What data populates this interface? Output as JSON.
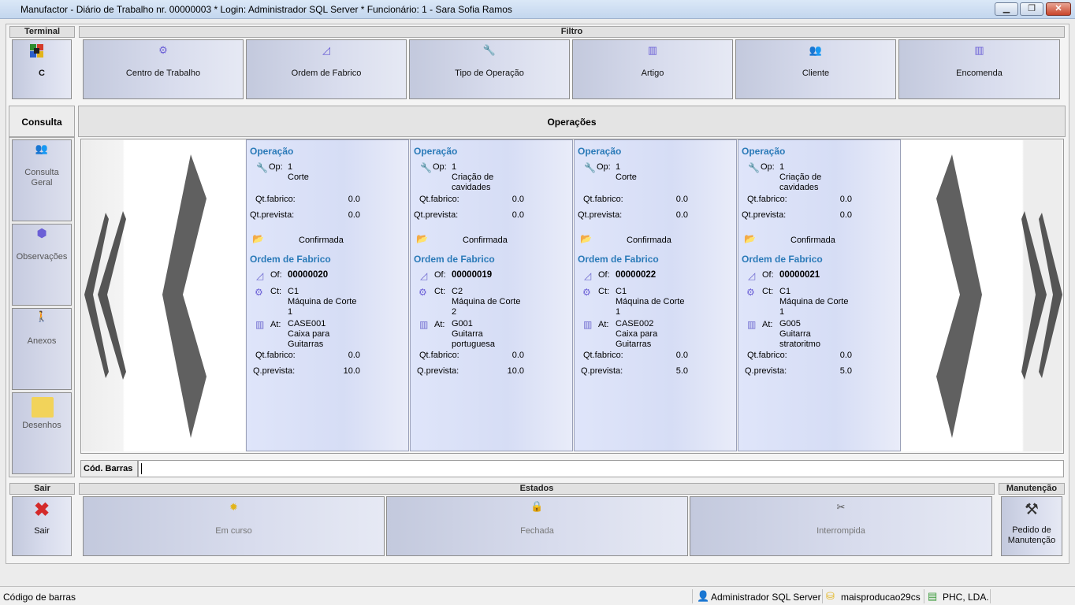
{
  "window": {
    "title": "Manufactor - Diário de Trabalho nr. 00000003 * Login: Administrador SQL Server * Funcionário: 1 - Sara Sofia Ramos"
  },
  "terminal": {
    "header": "Terminal",
    "value": "C"
  },
  "filtro": {
    "header": "Filtro",
    "buttons": [
      "Centro de Trabalho",
      "Ordem de Fabrico",
      "Tipo de Operação",
      "Artigo",
      "Cliente",
      "Encomenda"
    ]
  },
  "consulta": {
    "header": "Consulta",
    "items": [
      {
        "label_1": "Consulta",
        "label_2": "Geral"
      },
      {
        "label_1": "Observações"
      },
      {
        "label_1": "Anexos"
      },
      {
        "label_1": "Desenhos"
      }
    ]
  },
  "operacoes": {
    "header": "Operações"
  },
  "labels": {
    "operacao": "Operação",
    "op": "Op:",
    "qt_fabrico": "Qt.fabrico:",
    "qt_prevista": "Qt.prevista:",
    "ordem_fabrico": "Ordem de Fabrico",
    "of": "Of:",
    "ct": "Ct:",
    "at": "At:",
    "q_fabrico": "Qt.fabrico:",
    "q_prevista": "Q.prevista:"
  },
  "cards": [
    {
      "op_num": "1",
      "op_name_1": "Corte",
      "op_name_2": "",
      "qt_fabrico": "0.0",
      "qt_prevista": "0.0",
      "estado": "Confirmada",
      "of": "00000020",
      "ct_1": "C1",
      "ct_2": "Máquina de Corte",
      "ct_3": "1",
      "at_1": "CASE001",
      "at_2": "Caixa para",
      "at_3": "Guitarras",
      "of_qt_fabrico": "0.0",
      "of_q_prevista": "10.0"
    },
    {
      "op_num": "1",
      "op_name_1": "Criação de",
      "op_name_2": "cavidades",
      "qt_fabrico": "0.0",
      "qt_prevista": "0.0",
      "estado": "Confirmada",
      "of": "00000019",
      "ct_1": "C2",
      "ct_2": "Máquina de Corte",
      "ct_3": "2",
      "at_1": "G001",
      "at_2": "Guitarra",
      "at_3": "portuguesa",
      "of_qt_fabrico": "0.0",
      "of_q_prevista": "10.0"
    },
    {
      "op_num": "1",
      "op_name_1": "Corte",
      "op_name_2": "",
      "qt_fabrico": "0.0",
      "qt_prevista": "0.0",
      "estado": "Confirmada",
      "of": "00000022",
      "ct_1": "C1",
      "ct_2": "Máquina de Corte",
      "ct_3": "1",
      "at_1": "CASE002",
      "at_2": "Caixa para",
      "at_3": "Guitarras",
      "of_qt_fabrico": "0.0",
      "of_q_prevista": "5.0"
    },
    {
      "op_num": "1",
      "op_name_1": "Criação de",
      "op_name_2": "cavidades",
      "qt_fabrico": "0.0",
      "qt_prevista": "0.0",
      "estado": "Confirmada",
      "of": "00000021",
      "ct_1": "C1",
      "ct_2": "Máquina de Corte",
      "ct_3": "1",
      "at_1": "G005",
      "at_2": "Guitarra",
      "at_3": "stratoritmo",
      "of_qt_fabrico": "0.0",
      "of_q_prevista": "5.0"
    }
  ],
  "barcode": {
    "label": "Cód. Barras",
    "value": ""
  },
  "sair": {
    "header": "Sair",
    "label": "Sair"
  },
  "estados": {
    "header": "Estados",
    "buttons": [
      "Em curso",
      "Fechada",
      "Interrompida"
    ]
  },
  "manutencao": {
    "header": "Manutenção",
    "label_1": "Pedido de",
    "label_2": "Manutenção"
  },
  "statusbar": {
    "left": "Código de barras",
    "user": "Administrador SQL Server",
    "db": "maisproducao29cs",
    "company": "PHC, LDA."
  },
  "colors": {
    "section_title": "#2a7ab8",
    "close_red": "#d42a2a",
    "icon_purple": "#6b5fd6"
  }
}
